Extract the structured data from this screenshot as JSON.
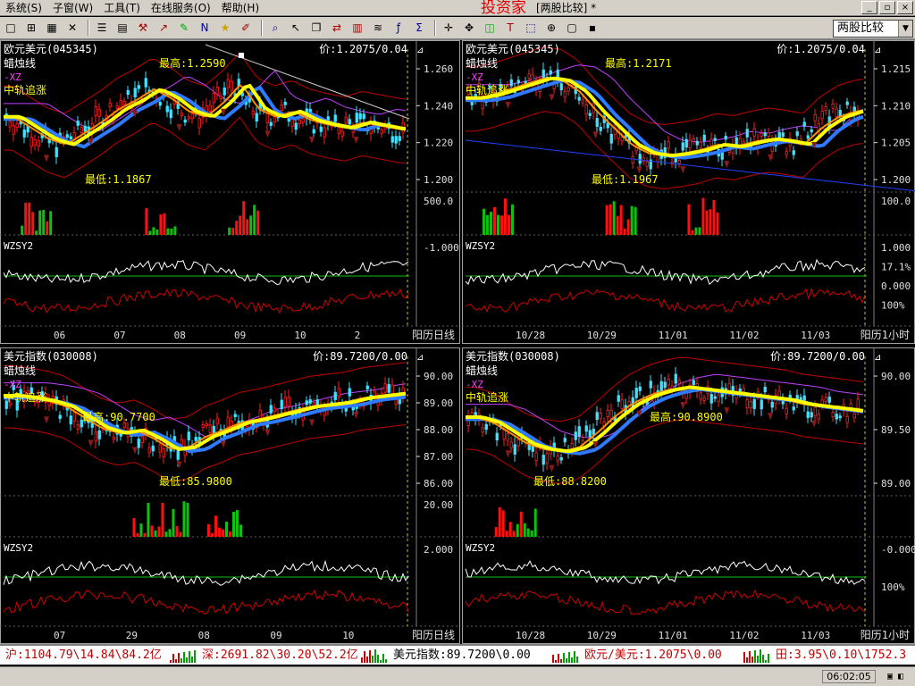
{
  "menu": {
    "items": [
      "系统(S)",
      "子窗(W)",
      "工具(T)",
      "在线服务(O)",
      "帮助(H)"
    ],
    "brand": "投资家",
    "mode": "[两股比较] *"
  },
  "window_controls": [
    "_",
    "▫",
    "×"
  ],
  "toolbar": {
    "icons": [
      "layout-1-icon",
      "layout-4-icon",
      "layout-grid-icon",
      "close-icon",
      "list-icon",
      "table-icon",
      "tools-icon",
      "chart-line-icon",
      "draw-icon",
      "news-icon",
      "favorite-icon",
      "pencil-icon",
      "search-icon",
      "cursor-icon",
      "copy-icon",
      "compare-icon",
      "grid-icon",
      "indicator-icon",
      "function-icon",
      "formula-icon",
      "crosshair-icon",
      "move-icon",
      "chart-type-icon",
      "text-icon",
      "select-icon",
      "zoom-icon",
      "window-icon",
      "save-icon"
    ],
    "select_value": "两股比较"
  },
  "panels": [
    {
      "id": "top-left",
      "title": "欧元美元(045345)",
      "price_label": "价:1.2075/0.04",
      "type_label": "蜡烛线",
      "xz_label": "-XZ",
      "strategy_label": "中轨追涨",
      "high_label": "最高:1.2590",
      "low_label": "最低:1.1867",
      "y_ticks": [
        "1.260",
        "1.240",
        "1.220",
        "1.200"
      ],
      "vol_tick": "500.0",
      "indicator_label": "WZSY2",
      "ind_ticks": [
        "-1.000"
      ],
      "x_ticks": [
        "06",
        "07",
        "08",
        "09",
        "10",
        "2"
      ],
      "period_label": "阳历日线"
    },
    {
      "id": "top-right",
      "title": "欧元美元(045345)",
      "price_label": "价:1.2075/0.04",
      "type_label": "蜡烛线",
      "xz_label": "-XZ",
      "strategy_label": "中轨追涨",
      "high_label": "最高:1.2171",
      "low_label": "最低:1.1967",
      "y_ticks": [
        "1.215",
        "1.210",
        "1.205",
        "1.200"
      ],
      "vol_tick": "100.0",
      "indicator_label": "WZSY2",
      "ind_ticks": [
        "1.000",
        "17.1%",
        "0.000",
        "100%"
      ],
      "x_ticks": [
        "10/28",
        "10/29",
        "11/01",
        "11/02",
        "11/03"
      ],
      "period_label": "阳历1小时"
    },
    {
      "id": "bottom-left",
      "title": "美元指数(030008)",
      "price_label": "价:89.7200/0.00",
      "type_label": "蜡烛线",
      "xz_label": "-XZ",
      "strategy_label": "中轨追涨",
      "high_label": "最高:90.7700",
      "low_label": "最低:85.9800",
      "y_ticks": [
        "90.00",
        "89.00",
        "88.00",
        "87.00",
        "86.00"
      ],
      "vol_tick": "20.00",
      "indicator_label": "WZSY2",
      "ind_ticks": [
        "2.000"
      ],
      "x_ticks": [
        "07",
        "29",
        "08",
        "09",
        "10"
      ],
      "period_label": "阳历日线"
    },
    {
      "id": "bottom-right",
      "title": "美元指数(030008)",
      "price_label": "价:89.7200/0.00",
      "type_label": "蜡烛线",
      "xz_label": "-XZ",
      "strategy_label": "中轨追涨",
      "high_label": "最高:90.8900",
      "low_label": "最低:88.8200",
      "y_ticks": [
        "90.00",
        "89.50",
        "89.00"
      ],
      "vol_tick": "",
      "indicator_label": "WZSY2",
      "ind_ticks": [
        "-0.000",
        "100%"
      ],
      "x_ticks": [
        "10/28",
        "10/29",
        "11/01",
        "11/02",
        "11/03"
      ],
      "period_label": "阳历1小时"
    }
  ],
  "ticker": [
    {
      "text": "沪:1104.79\\14.84\\84.2亿",
      "color": "red"
    },
    {
      "text": "深:2691.82\\30.20\\52.2亿",
      "color": "red"
    },
    {
      "text": "美元指数:89.7200\\0.00",
      "color": "black"
    },
    {
      "text": "欧元/美元:1.2075\\0.00",
      "color": "red"
    },
    {
      "text": "田:3.95\\0.10\\1752.3",
      "color": "red"
    }
  ],
  "status": {
    "clock": "06:02:05"
  },
  "colors": {
    "candle_up": "#ff2020",
    "candle_down": "#40e0ff",
    "ma_yellow": "#ffff00",
    "ma_blue": "#2e7bff",
    "ma_orange": "#ff8a00",
    "ma_magenta": "#c040ff",
    "band_red": "#c00000",
    "label_white": "#ffffff",
    "label_yellow": "#ffff00",
    "label_magenta": "#ff40ff",
    "axis_white": "#e0e0e0"
  }
}
